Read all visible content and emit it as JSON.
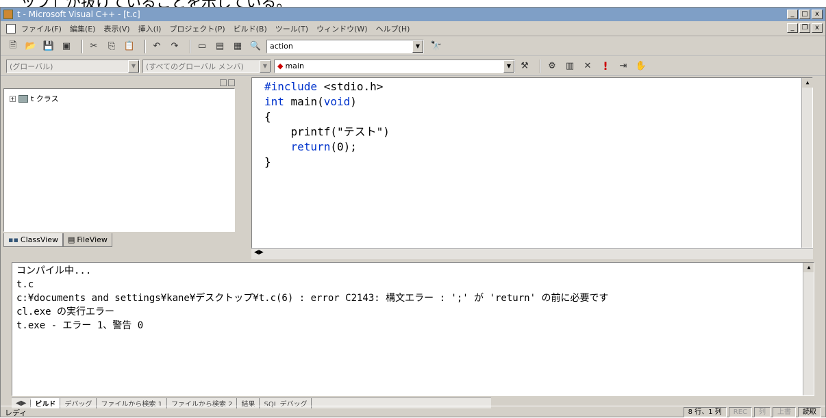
{
  "caption_top": "ッフ」が抜けていることを示している。",
  "window": {
    "title": "t - Microsoft Visual C++ - [t.c]"
  },
  "menu": [
    "ファイル(F)",
    "編集(E)",
    "表示(V)",
    "挿入(I)",
    "プロジェクト(P)",
    "ビルド(B)",
    "ツール(T)",
    "ウィンドウ(W)",
    "ヘルプ(H)"
  ],
  "toolbar": {
    "find_combo": "action",
    "scope_combo": "(グローバル)",
    "members_combo": "(すべてのグローバル メンバ)",
    "function_combo": "main"
  },
  "workspace": {
    "tree_root": "t クラス",
    "tabs": [
      "ClassView",
      "FileView"
    ]
  },
  "editor": {
    "lines": [
      "#include <stdio.h>",
      "",
      "int main(void)",
      "{",
      "    printf(\"テスト\")",
      "    return(0);",
      "}"
    ]
  },
  "output": {
    "lines": [
      "コンパイル中...",
      "t.c",
      "c:¥documents and settings¥kane¥デスクトップ¥t.c(6) : error C2143: 構文エラー : ';' が 'return' の前に必要です",
      "cl.exe の実行エラー",
      "",
      "t.exe - エラー 1、警告 0"
    ],
    "tabs": [
      "ビルド",
      "デバッグ",
      "ファイルから検索 1",
      "ファイルから検索 2",
      "結果",
      "SQL デバッグ"
    ]
  },
  "status": {
    "left": "レディ",
    "position": "8 行、1 列",
    "rec": "REC",
    "col": "列",
    "ovr": "上書",
    "read": "読取"
  }
}
